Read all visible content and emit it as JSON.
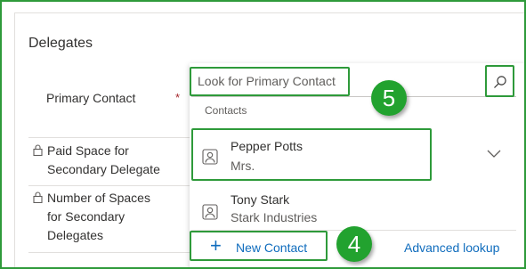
{
  "section": {
    "title": "Delegates"
  },
  "fields": {
    "primary_contact": {
      "label": "Primary Contact",
      "required_mark": "*"
    },
    "paid_space": {
      "label_line1": "Paid Space for",
      "label_line2": "Secondary Delegate"
    },
    "spaces_count": {
      "label_line1": "Number of Spaces",
      "label_line2": "for Secondary",
      "label_line3": "Delegates"
    }
  },
  "lookup": {
    "placeholder": "Look for Primary Contact",
    "group_label": "Contacts",
    "results": [
      {
        "name": "Pepper Potts",
        "secondary": "Mrs."
      },
      {
        "name": "Tony Stark",
        "secondary": "Stark Industries"
      }
    ],
    "new_label": "New Contact",
    "advanced_label": "Advanced lookup"
  },
  "annotations": {
    "step_a": "5",
    "step_b": "4"
  },
  "colors": {
    "highlight": "#2e9a3a",
    "badge": "#22a22f",
    "link": "#0f6cbd",
    "required": "#a4262c"
  }
}
